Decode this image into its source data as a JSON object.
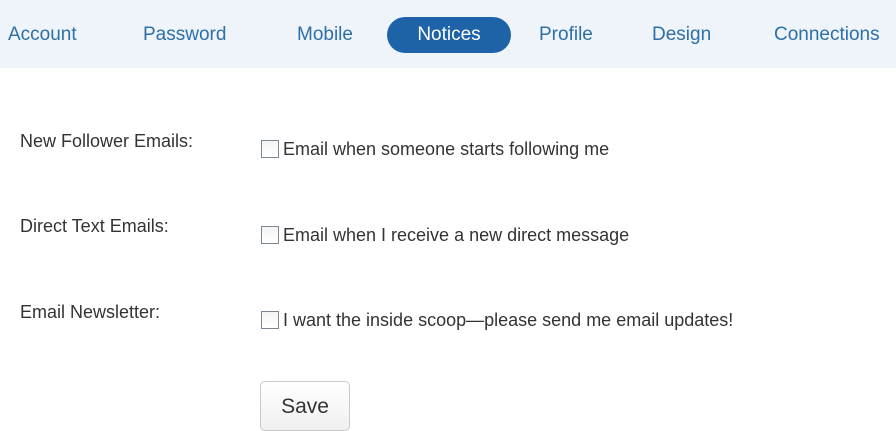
{
  "tabs": [
    {
      "label": "Account"
    },
    {
      "label": "Password"
    },
    {
      "label": "Mobile"
    },
    {
      "label": "Notices",
      "active": true
    },
    {
      "label": "Profile"
    },
    {
      "label": "Design"
    },
    {
      "label": "Connections"
    }
  ],
  "settings": [
    {
      "label": "New Follower Emails:",
      "option": "Email when someone starts following me",
      "checked": false
    },
    {
      "label": "Direct Text Emails:",
      "option": "Email when I receive a new direct message",
      "checked": false
    },
    {
      "label": "Email Newsletter:",
      "option": "I want the inside scoop—please send me email updates!",
      "checked": false
    }
  ],
  "save_label": "Save",
  "colors": {
    "tabbar_bg": "#eef4f9",
    "tab_text": "#2e6fa8",
    "active_tab_bg": "#1e63a8",
    "active_tab_text": "#ffffff"
  }
}
